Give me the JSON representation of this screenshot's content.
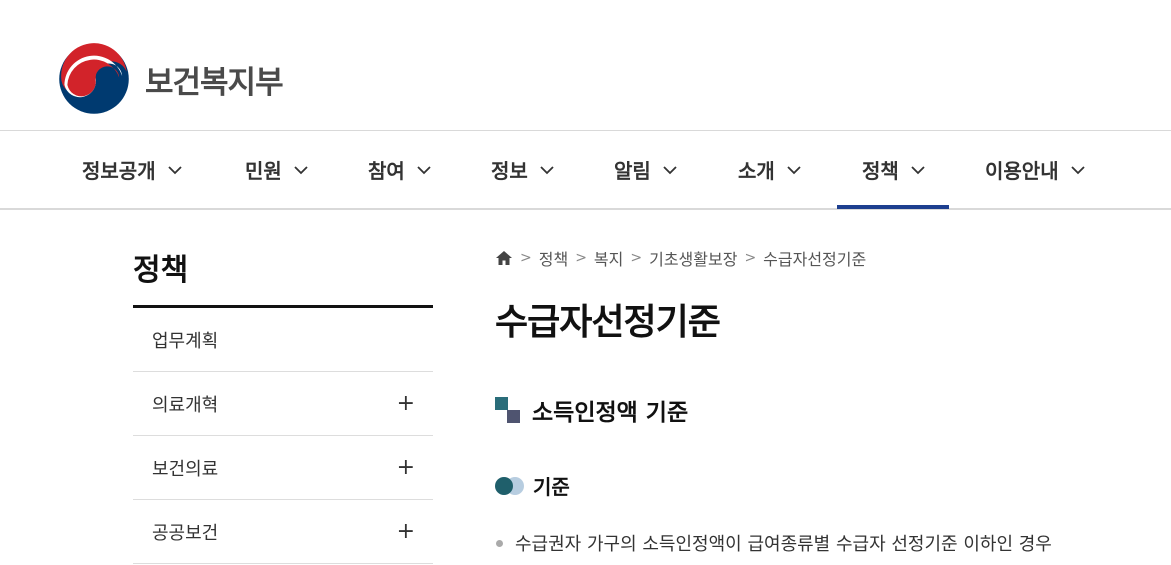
{
  "header": {
    "logo_text": "보건복지부",
    "logo_colors": {
      "red": "#d2232a",
      "blue": "#003a70"
    }
  },
  "gnb": {
    "items": [
      {
        "label": "정보공개",
        "active": false
      },
      {
        "label": "민원",
        "active": false
      },
      {
        "label": "참여",
        "active": false
      },
      {
        "label": "정보",
        "active": false
      },
      {
        "label": "알림",
        "active": false
      },
      {
        "label": "소개",
        "active": false
      },
      {
        "label": "정책",
        "active": true
      },
      {
        "label": "이용안내",
        "active": false
      }
    ],
    "active_color": "#1d3f8f"
  },
  "lnb": {
    "title": "정책",
    "items": [
      {
        "label": "업무계획",
        "expandable": false
      },
      {
        "label": "의료개혁",
        "expandable": true
      },
      {
        "label": "보건의료",
        "expandable": true
      },
      {
        "label": "공공보건",
        "expandable": true
      }
    ],
    "expand_symbol": "+"
  },
  "breadcrumb": {
    "home_icon": "home-icon",
    "items": [
      "정책",
      "복지",
      "기초생활보장",
      "수급자선정기준"
    ],
    "separator": ">"
  },
  "main": {
    "page_title": "수급자선정기준",
    "section_title": "소득인정액 기준",
    "subsection_title": "기준",
    "bullet_text": "수급권자 가구의 소득인정액이 급여종류별 수급자 선정기준 이하인 경우"
  }
}
